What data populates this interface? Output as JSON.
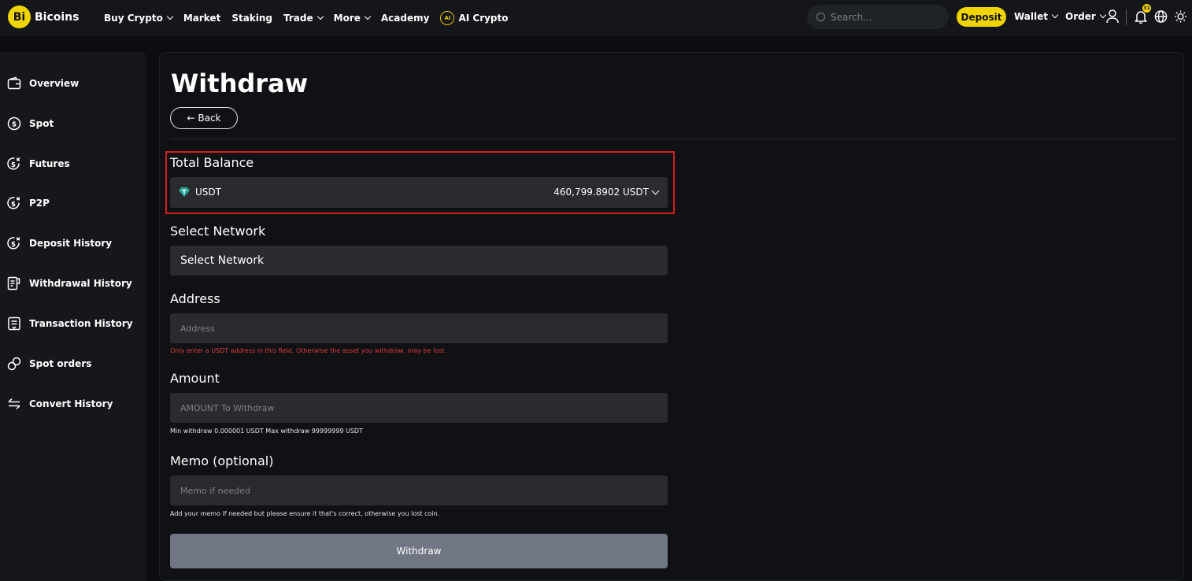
{
  "brand": {
    "logo_mark": "Bi",
    "name": "Bicoins"
  },
  "nav": {
    "items": [
      {
        "label": "Buy Crypto",
        "has_dropdown": true
      },
      {
        "label": "Market",
        "has_dropdown": false
      },
      {
        "label": "Staking",
        "has_dropdown": false
      },
      {
        "label": "Trade",
        "has_dropdown": true
      },
      {
        "label": "More",
        "has_dropdown": true
      },
      {
        "label": "Academy",
        "has_dropdown": false
      }
    ],
    "ai_icon_text": "AI",
    "ai_label": "AI Crypto"
  },
  "header": {
    "search_placeholder": "Search...",
    "deposit_label": "Deposit",
    "wallet_label": "Wallet",
    "order_label": "Order",
    "notification_count": "31",
    "accent_color": "#f0d400"
  },
  "sidebar": {
    "items": [
      {
        "label": "Overview",
        "icon": "wallet-icon"
      },
      {
        "label": "Spot",
        "icon": "dollar-coin-icon"
      },
      {
        "label": "Futures",
        "icon": "coin-arrow-icon"
      },
      {
        "label": "P2P",
        "icon": "coin-arrow-icon"
      },
      {
        "label": "Deposit History",
        "icon": "coin-arrow-icon"
      },
      {
        "label": "Withdrawal History",
        "icon": "receipt-icon"
      },
      {
        "label": "Transaction History",
        "icon": "document-icon"
      },
      {
        "label": "Spot orders",
        "icon": "link-icon"
      },
      {
        "label": "Convert History",
        "icon": "swap-arrows-icon"
      }
    ]
  },
  "page": {
    "title": "Withdraw",
    "back_label": "← Back"
  },
  "form": {
    "balance_label": "Total Balance",
    "coin": "USDT",
    "coin_icon": "tether-gem-icon",
    "balance_value": "460,799.8902 USDT",
    "network_label": "Select Network",
    "network_value": "Select Network",
    "address_label": "Address",
    "address_placeholder": "Address",
    "address_warning": "Only enter a USDT address in this field. Otherwise the asset you withdraw, may be lost.",
    "amount_label": "Amount",
    "amount_placeholder": "AMOUNT To Withdraw",
    "amount_limits": "Min withdraw 0.000001 USDT  Max withdraw 99999999 USDT",
    "memo_label": "Memo (optional)",
    "memo_placeholder": "Memo if needed",
    "memo_note": "Add your memo if needed but please ensure it that's correct, otherwise you lost coin.",
    "submit_label": "Withdraw",
    "highlight_color": "#d21f1f",
    "warning_color": "#e23a3a"
  }
}
